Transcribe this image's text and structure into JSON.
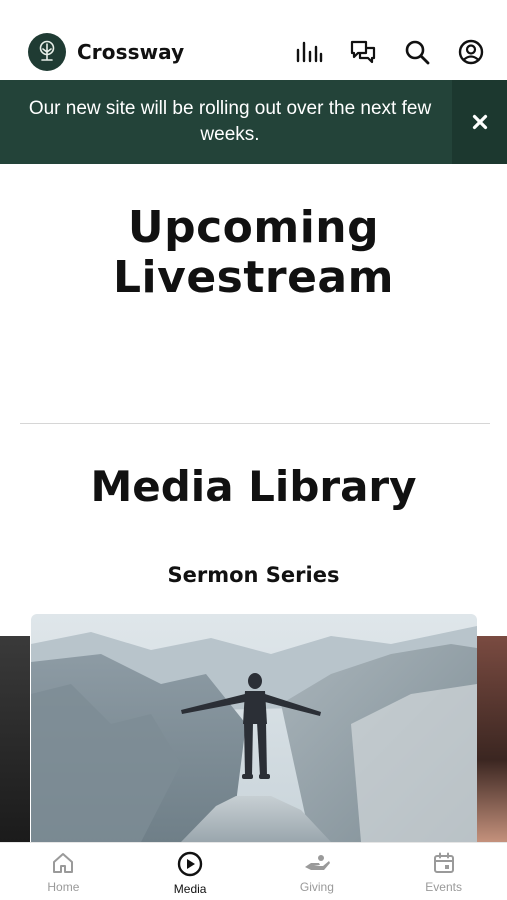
{
  "app": {
    "brand": "Crossway"
  },
  "header": {
    "icons": [
      "equalizer-icon",
      "chat-icon",
      "search-icon",
      "account-icon"
    ]
  },
  "banner": {
    "message": "Our new site will be rolling out over the next few weeks.",
    "close_icon": "close-icon"
  },
  "sections": {
    "upcoming_title": "Upcoming Livestream",
    "media_title": "Media Library",
    "series_title": "Sermon Series"
  },
  "tabs": [
    {
      "label": "Home",
      "icon": "home-icon",
      "active": false
    },
    {
      "label": "Media",
      "icon": "play-circle-icon",
      "active": true
    },
    {
      "label": "Giving",
      "icon": "giving-hand-icon",
      "active": false
    },
    {
      "label": "Events",
      "icon": "calendar-icon",
      "active": false
    }
  ],
  "colors": {
    "brand_dark": "#1f3b33",
    "banner_bg": "#234339",
    "tab_inactive": "#9a9a9a",
    "tab_active": "#111111"
  }
}
